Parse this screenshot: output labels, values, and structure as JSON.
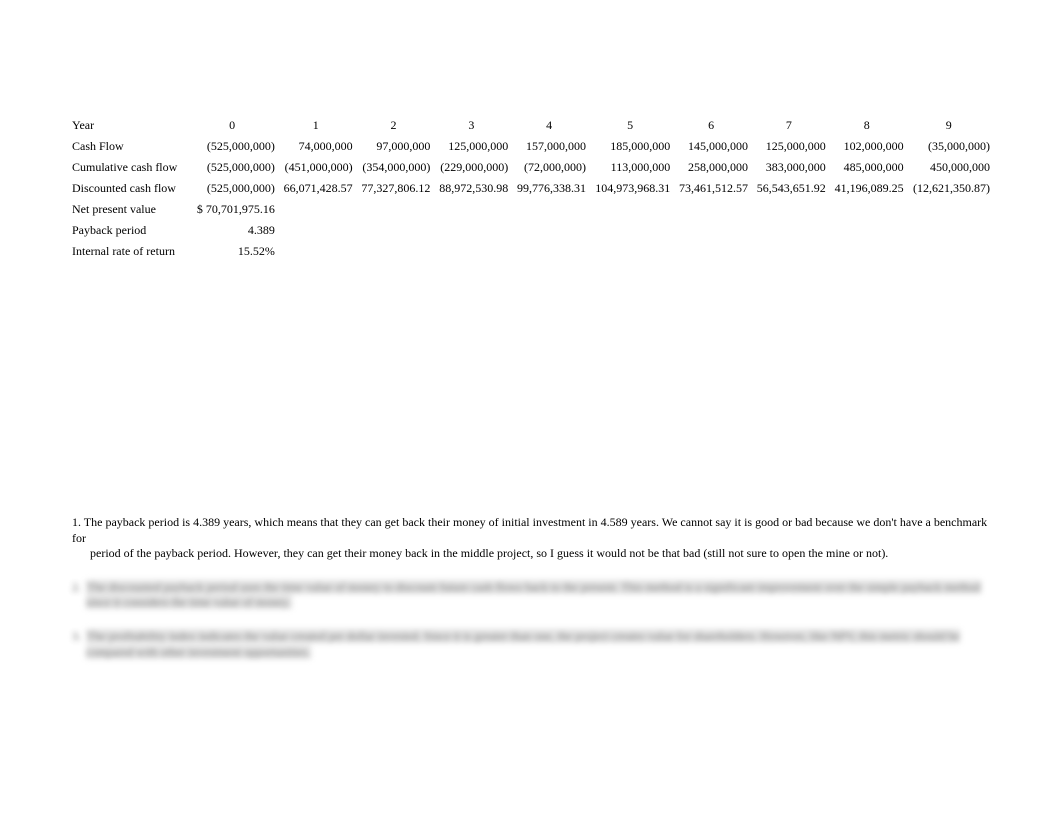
{
  "table": {
    "labels": {
      "year": "Year",
      "cash_flow": "Cash Flow",
      "cum_cf": "Cumulative cash flow",
      "dcf": "Discounted cash flow",
      "npv": "Net present value",
      "payback": "Payback period",
      "irr": "Internal rate of return"
    },
    "years": [
      "0",
      "1",
      "2",
      "3",
      "4",
      "5",
      "6",
      "7",
      "8",
      "9"
    ],
    "cash_flow": [
      "(525,000,000)",
      "74,000,000",
      "97,000,000",
      "125,000,000",
      "157,000,000",
      "185,000,000",
      "145,000,000",
      "125,000,000",
      "102,000,000",
      "(35,000,000)"
    ],
    "cum_cf": [
      "(525,000,000)",
      "(451,000,000)",
      "(354,000,000)",
      "(229,000,000)",
      "(72,000,000)",
      "113,000,000",
      "258,000,000",
      "383,000,000",
      "485,000,000",
      "450,000,000"
    ],
    "dcf": [
      "(525,000,000)",
      "66,071,428.57",
      "77,327,806.12",
      "88,972,530.98",
      "99,776,338.31",
      "104,973,968.31",
      "73,461,512.57",
      "56,543,651.92",
      "41,196,089.25",
      "(12,621,350.87)"
    ],
    "npv_s": "$",
    "npv_val": "70,701,975.16",
    "payback_val": "4.389",
    "irr_val": "15.52%"
  },
  "notes": {
    "n1_line1": "1. The payback period is 4.389 years, which means that they can get back their money of initial investment in 4.589 years. We cannot say it is good or bad because we don't have a benchmark for",
    "n1_line2": "period of the payback period. However, they can get their money back in the middle project, so I guess it would not be that bad (still not sure to open the mine or not).",
    "n2_num": "2.",
    "n2_body": "The discounted payback period uses the time value of money to discount future cash flows back to the present. This method is a significant improvement over the simple payback method since it considers the time value of money.",
    "n3_num": "3.",
    "n3_body": "The profitability index indicates the value created per dollar invested. Since it is greater than one, the project creates value for shareholders. However, like NPV, this metric should be compared with other investment opportunities."
  }
}
